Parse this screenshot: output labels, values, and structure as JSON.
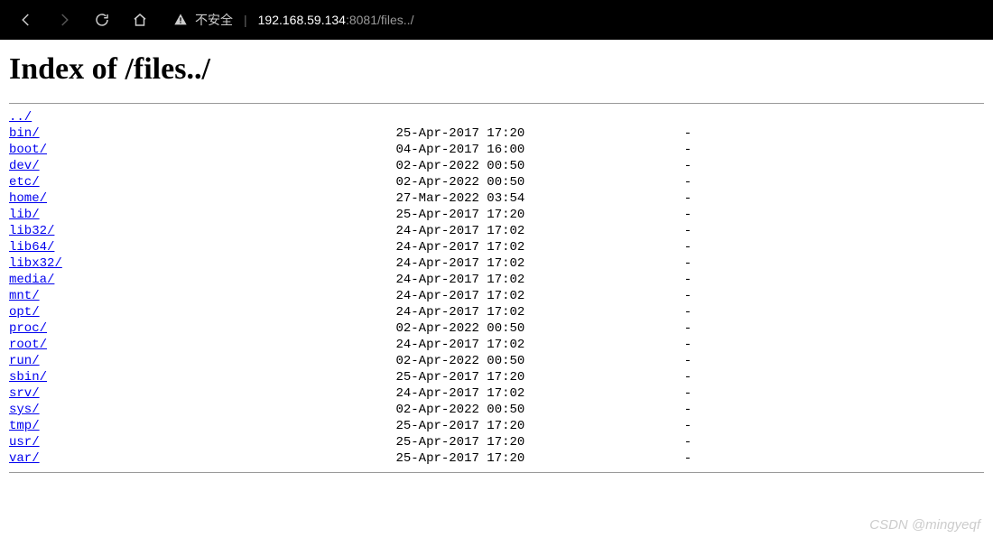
{
  "browser": {
    "security_label": "不安全",
    "url_host": "192.168.59.134",
    "url_port_path": ":8081/files../"
  },
  "page": {
    "title": "Index of /files../",
    "parent_link": "../",
    "entries": [
      {
        "name": "bin/",
        "date": "25-Apr-2017 17:20",
        "size": "-"
      },
      {
        "name": "boot/",
        "date": "04-Apr-2017 16:00",
        "size": "-"
      },
      {
        "name": "dev/",
        "date": "02-Apr-2022 00:50",
        "size": "-"
      },
      {
        "name": "etc/",
        "date": "02-Apr-2022 00:50",
        "size": "-"
      },
      {
        "name": "home/",
        "date": "27-Mar-2022 03:54",
        "size": "-"
      },
      {
        "name": "lib/",
        "date": "25-Apr-2017 17:20",
        "size": "-"
      },
      {
        "name": "lib32/",
        "date": "24-Apr-2017 17:02",
        "size": "-"
      },
      {
        "name": "lib64/",
        "date": "24-Apr-2017 17:02",
        "size": "-"
      },
      {
        "name": "libx32/",
        "date": "24-Apr-2017 17:02",
        "size": "-"
      },
      {
        "name": "media/",
        "date": "24-Apr-2017 17:02",
        "size": "-"
      },
      {
        "name": "mnt/",
        "date": "24-Apr-2017 17:02",
        "size": "-"
      },
      {
        "name": "opt/",
        "date": "24-Apr-2017 17:02",
        "size": "-"
      },
      {
        "name": "proc/",
        "date": "02-Apr-2022 00:50",
        "size": "-"
      },
      {
        "name": "root/",
        "date": "24-Apr-2017 17:02",
        "size": "-"
      },
      {
        "name": "run/",
        "date": "02-Apr-2022 00:50",
        "size": "-"
      },
      {
        "name": "sbin/",
        "date": "25-Apr-2017 17:20",
        "size": "-"
      },
      {
        "name": "srv/",
        "date": "24-Apr-2017 17:02",
        "size": "-"
      },
      {
        "name": "sys/",
        "date": "02-Apr-2022 00:50",
        "size": "-"
      },
      {
        "name": "tmp/",
        "date": "25-Apr-2017 17:20",
        "size": "-"
      },
      {
        "name": "usr/",
        "date": "25-Apr-2017 17:20",
        "size": "-"
      },
      {
        "name": "var/",
        "date": "25-Apr-2017 17:20",
        "size": "-"
      }
    ]
  },
  "watermark": "CSDN @mingyeqf"
}
